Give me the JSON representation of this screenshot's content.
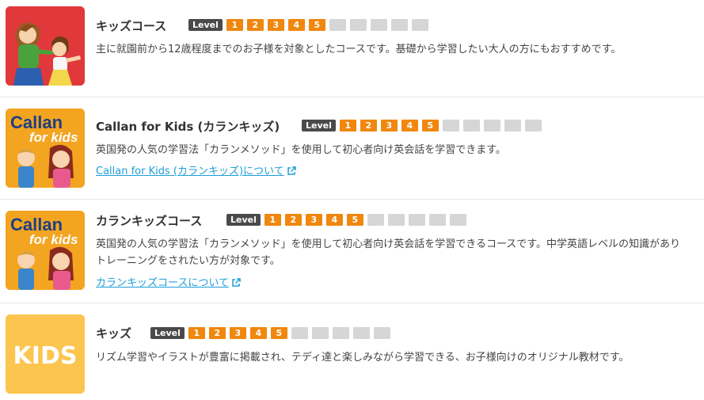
{
  "level_label": "Level",
  "level_numbers": [
    "1",
    "2",
    "3",
    "4",
    "5"
  ],
  "colors": {
    "level_active": "#f0870e",
    "level_inactive": "#d6d6d6",
    "link": "#1f9ed9",
    "kids_bg": "#fbc54f",
    "callan_bg": "#f3a421"
  },
  "courses": [
    {
      "title": "キッズコース",
      "levels_active": 5,
      "levels_total": 10,
      "description": "主に就園前から12歳程度までのお子様を対象としたコースです。基礎から学習したい大人の方にもおすすめです。",
      "link": "",
      "thumb_icon": "mother-child-illustration"
    },
    {
      "title": "Callan for Kids (カランキッズ)",
      "levels_active": 5,
      "levels_total": 10,
      "description": "英国発の人気の学習法「カランメソッド」を使用して初心者向け英会話を学習できます。",
      "link": "Callan for Kids (カランキッズ)について",
      "thumb_icon": "callan-for-kids-logo",
      "thumb_text_1": "Callan",
      "thumb_text_2": "for kids"
    },
    {
      "title": "カランキッズコース",
      "levels_active": 5,
      "levels_total": 10,
      "description": "英国発の人気の学習法「カランメソッド」を使用して初心者向け英会話を学習できるコースです。中学英語レベルの知識がありトレーニングをされたい方が対象です。",
      "link": "カランキッズコースについて",
      "thumb_icon": "callan-for-kids-logo",
      "thumb_text_1": "Callan",
      "thumb_text_2": "for kids"
    },
    {
      "title": "キッズ",
      "levels_active": 5,
      "levels_total": 10,
      "description": "リズム学習やイラストが豊富に掲載され、テディ達と楽しみながら学習できる、お子様向けのオリジナル教材です。",
      "link": "",
      "thumb_icon": "kids-logo",
      "thumb_text_1": "KIDS"
    }
  ]
}
